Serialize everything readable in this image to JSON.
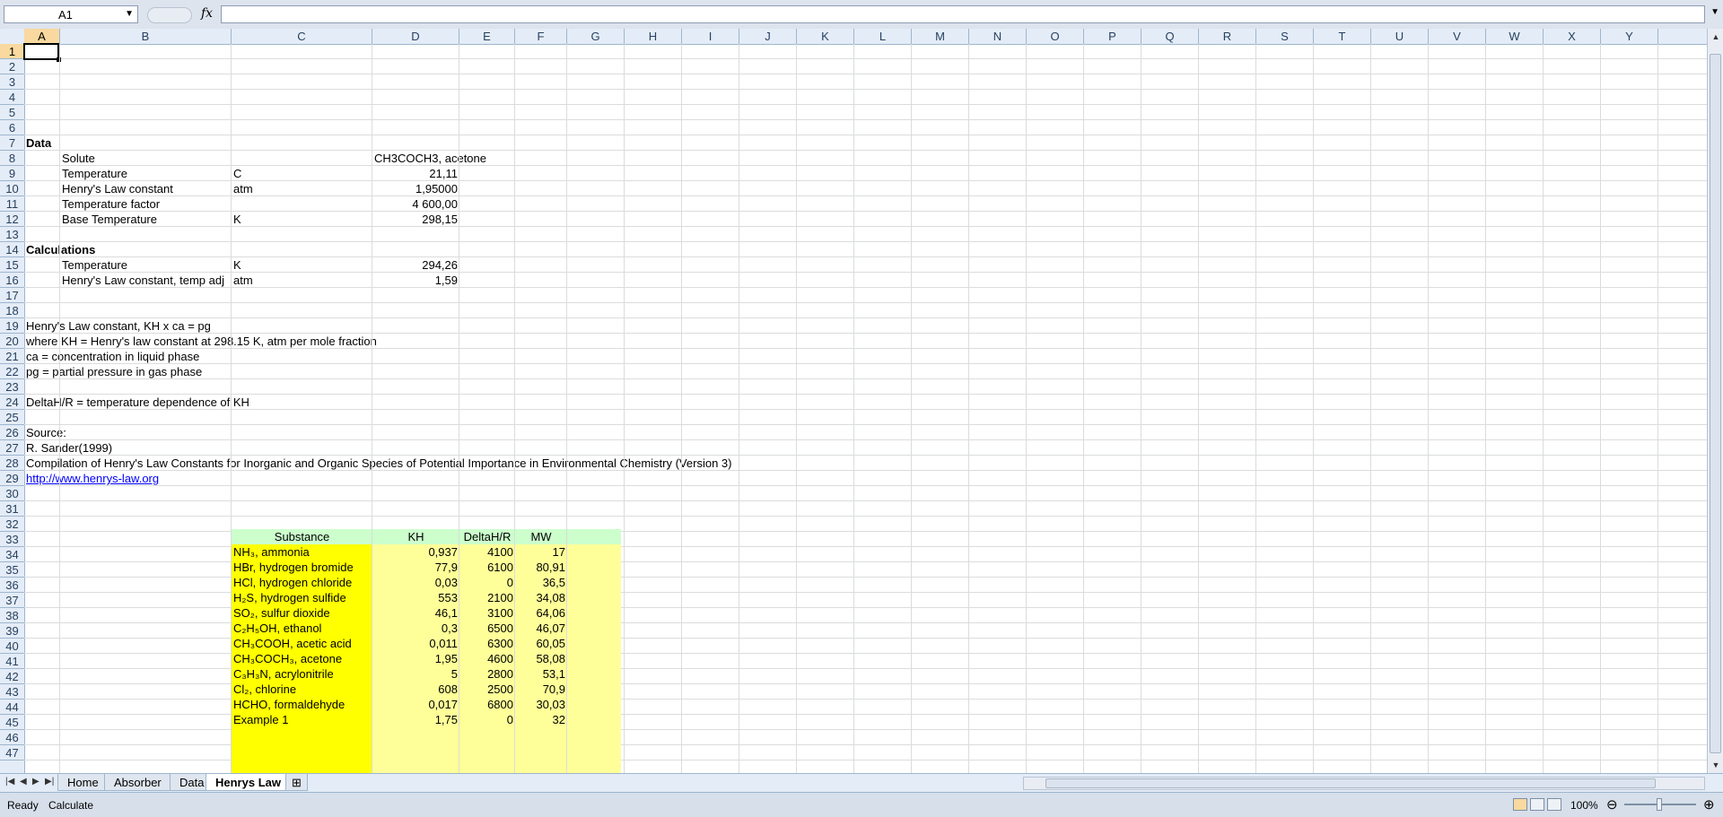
{
  "formula_bar": {
    "name_box": "A1",
    "fx_label": "fx",
    "formula": ""
  },
  "columns": [
    "A",
    "B",
    "C",
    "D",
    "E",
    "F",
    "G",
    "H",
    "I",
    "J",
    "K",
    "L",
    "M",
    "N",
    "O",
    "P",
    "Q",
    "R",
    "S",
    "T",
    "U",
    "V",
    "W",
    "X",
    "Y"
  ],
  "rows": [
    "1",
    "2",
    "3",
    "4",
    "5",
    "6",
    "7",
    "8",
    "9",
    "10",
    "11",
    "12",
    "13",
    "14",
    "15",
    "16",
    "17",
    "18",
    "19",
    "20",
    "21",
    "22",
    "23",
    "24",
    "25",
    "26",
    "27",
    "28",
    "29",
    "30",
    "31",
    "32",
    "33",
    "34",
    "35",
    "36",
    "37",
    "38",
    "39",
    "40",
    "41",
    "42",
    "43",
    "44",
    "45",
    "46",
    "47"
  ],
  "sheet": {
    "data_heading": "Data",
    "data_rows": [
      {
        "label": "Solute",
        "unit": "",
        "value": "CH3COCH3, acetone"
      },
      {
        "label": "Temperature",
        "unit": "C",
        "value": "21,11"
      },
      {
        "label": "Henry's Law constant",
        "unit": "atm",
        "value": "1,95000"
      },
      {
        "label": "Temperature factor",
        "unit": "",
        "value": "4 600,00"
      },
      {
        "label": "Base Temperature",
        "unit": "K",
        "value": "298,15"
      }
    ],
    "calc_heading": "Calculations",
    "calc_rows": [
      {
        "label": "Temperature",
        "unit": "K",
        "value": "294,26"
      },
      {
        "label": "Henry's Law constant, temp adj",
        "unit": "atm",
        "value": "1,59"
      }
    ],
    "notes": [
      "Henry's Law constant, KH x ca = pg",
      "where KH = Henry's law constant at 298.15 K, atm per mole fraction",
      "ca = concentration in liquid phase",
      "pg = partial pressure in gas phase",
      "DeltaH/R = temperature dependence of KH",
      "Source:",
      "R. Sander(1999)",
      "Compilation of Henry's Law Constants for Inorganic and Organic Species of Potential Importance in Environmental Chemistry (Version 3)"
    ],
    "link": "http://www.henrys-law.org",
    "table": {
      "headers": [
        "Substance",
        "KH",
        "DeltaH/R",
        "MW"
      ],
      "rows": [
        [
          "NH₃, ammonia",
          "0,937",
          "4100",
          "17"
        ],
        [
          "HBr, hydrogen bromide",
          "77,9",
          "6100",
          "80,91"
        ],
        [
          "HCl, hydrogen chloride",
          "0,03",
          "0",
          "36,5"
        ],
        [
          "H₂S, hydrogen sulfide",
          "553",
          "2100",
          "34,08"
        ],
        [
          "SO₂, sulfur dioxide",
          "46,1",
          "3100",
          "64,06"
        ],
        [
          "C₂H₅OH, ethanol",
          "0,3",
          "6500",
          "46,07"
        ],
        [
          "CH₃COOH, acetic acid",
          "0,011",
          "6300",
          "60,05"
        ],
        [
          "CH₃COCH₃, acetone",
          "1,95",
          "4600",
          "58,08"
        ],
        [
          "C₃H₃N, acrylonitrile",
          "5",
          "2800",
          "53,1"
        ],
        [
          "Cl₂, chlorine",
          "608",
          "2500",
          "70,9"
        ],
        [
          "HCHO, formaldehyde",
          "0,017",
          "6800",
          "30,03"
        ],
        [
          "Example 1",
          "1,75",
          "0",
          "32"
        ]
      ]
    }
  },
  "tabs": [
    "Home",
    "Absorber",
    "Data",
    "Henrys Law"
  ],
  "active_tab": "Henrys Law",
  "status": {
    "ready": "Ready",
    "calculate": "Calculate",
    "zoom": "100%"
  },
  "colors": {
    "yellow": "#ffff00",
    "light_yellow": "#ffff99",
    "header_green": "#ccffcc",
    "selection": "#f9d99f"
  }
}
